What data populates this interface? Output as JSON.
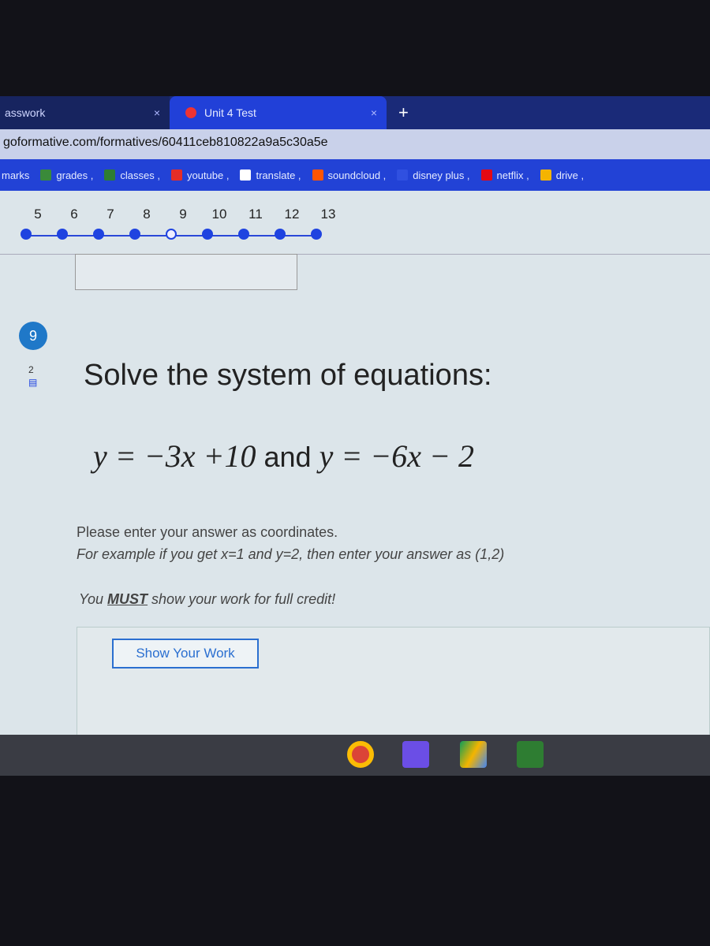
{
  "browser": {
    "tabs": [
      {
        "label": "asswork"
      },
      {
        "label": "Unit 4 Test"
      }
    ],
    "new_tab": "+",
    "close": "×",
    "url": "goformative.com/formatives/60411ceb810822a9a5c30a5e",
    "bookmarks": [
      {
        "label": "marks",
        "icon": "none"
      },
      {
        "label": "grades ,",
        "icon": "leaf-icon",
        "color": "#3a8a3a"
      },
      {
        "label": "classes ,",
        "icon": "classroom-icon",
        "color": "#2e7d32"
      },
      {
        "label": "youtube ,",
        "icon": "youtube-icon",
        "color": "#e52d27"
      },
      {
        "label": "translate ,",
        "icon": "google-icon",
        "color": "#ffffff"
      },
      {
        "label": "soundcloud ,",
        "icon": "soundcloud-icon",
        "color": "#ff5500"
      },
      {
        "label": "disney plus ,",
        "icon": "disney-icon",
        "color": "#3050e0"
      },
      {
        "label": "netflix ,",
        "icon": "netflix-icon",
        "color": "#e50914"
      },
      {
        "label": "drive ,",
        "icon": "drive-icon",
        "color": "#f4b400"
      }
    ]
  },
  "questions": {
    "numbers": [
      "5",
      "6",
      "7",
      "8",
      "9",
      "10",
      "11",
      "12",
      "13"
    ],
    "current": "9",
    "answered": [
      true,
      true,
      true,
      true,
      false,
      true,
      true,
      true,
      true
    ]
  },
  "question": {
    "badge": "9",
    "points": "2",
    "title": "Solve the system of equations:",
    "eq1": "y = −3x +10",
    "and": "and",
    "eq2": "y = −6x − 2",
    "instr1": "Please enter your answer as coordinates.",
    "instr2": "For example if you get x=1 and y=2, then enter your answer as (1,2)",
    "must_pre": "You ",
    "must": "MUST",
    "must_post": " show your work for full credit!",
    "show_work": "Show Your Work"
  },
  "colors": {
    "accent": "#1f43e0",
    "bookmark_bar": "#2242d6"
  }
}
